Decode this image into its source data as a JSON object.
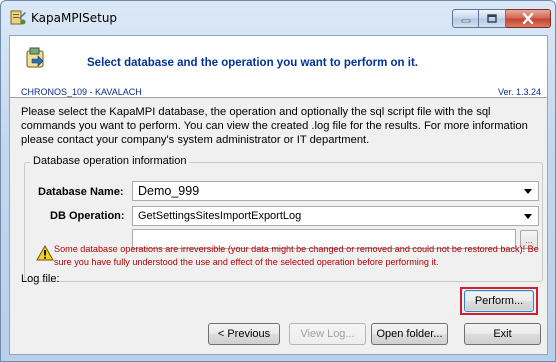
{
  "window": {
    "title": "KapaMPISetup"
  },
  "header": {
    "title": "Select database and the operation you want to perform on it.",
    "database_identifier": "CHRONOS_109 - KAVALACH",
    "version": "Ver. 1.3.24"
  },
  "description": "Please select the KapaMPI database, the operation and optionally the sql script file with the sql commands you want to perform. You can view the created .log file for the results. For more information please contact your company's system administrator or IT department.",
  "group": {
    "label": "Database operation information",
    "database_name_label": "Database Name:",
    "database_name_value": "Demo_999",
    "db_operation_label": "DB Operation:",
    "db_operation_value": "GetSettingsSitesImportExportLog",
    "script_file_value": "",
    "browse_label": "..."
  },
  "warning": "Some database operations are irreversible (your data might be changed or removed and could not be restored back)! Be sure you have fully understood the use and effect of the selected operation before performing it.",
  "log_file_label": "Log file:",
  "buttons": {
    "perform": "Perform...",
    "previous": "< Previous",
    "view_log": "View Log...",
    "open_folder": "Open folder...",
    "exit": "Exit"
  },
  "colors": {
    "header_title": "#003399",
    "warning_text": "#b30000",
    "highlight": "#d0202e"
  }
}
